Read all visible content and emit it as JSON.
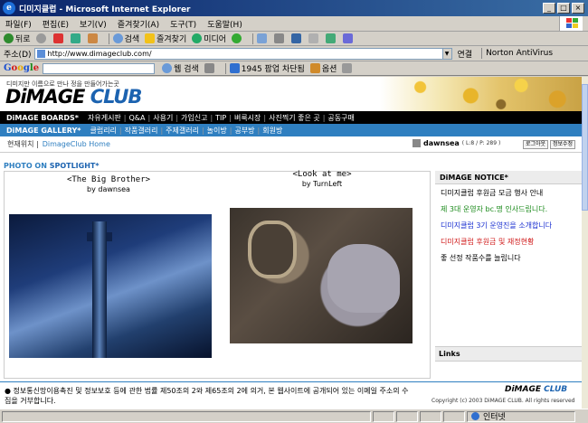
{
  "window": {
    "title": "디미지클럽 - Microsoft Internet Explorer",
    "min_glyph": "_",
    "max_glyph": "□",
    "close_glyph": "×"
  },
  "menu": {
    "items": [
      "파일(F)",
      "편집(E)",
      "보기(V)",
      "즐겨찾기(A)",
      "도구(T)",
      "도움말(H)"
    ]
  },
  "toolbar": {
    "back": "뒤로",
    "search": "검색",
    "favorites": "즐겨찾기",
    "media": "미디어"
  },
  "address": {
    "label": "주소(D)",
    "url": "http://www.dimageclub.com/",
    "go": "연결",
    "antivirus": "Norton AntiVirus"
  },
  "google": {
    "logo": "Google",
    "web_search": "웹 검색",
    "popup_blocked": "1945 팝업 차단됨",
    "options": "옵션"
  },
  "site": {
    "tagline": "디미지만 이름으로 만나 정을 만들어가는곳",
    "logo_main": "DiMAGE ",
    "logo_club": "CLUB",
    "boards_label": "DiMAGE BOARDS*",
    "boards": [
      "자유게시판",
      "Q&A",
      "사용기",
      "가입신고",
      "TIP",
      "벼룩시장",
      "사진찍기 좋은 곳",
      "공동구매"
    ],
    "gallery_label": "DiMAGE GALLERY*",
    "gallery": [
      "클럽리리",
      "작품갤러리",
      "주제갤러리",
      "놀이방",
      "공부방",
      "회원방"
    ],
    "crumb_here": "현재위치 |",
    "crumb_home": "DimageClub Home",
    "user_name": "dawnsea",
    "user_level": "( L:8 / P: 289 )",
    "logout": "로그아웃",
    "edit_info": "정보수정"
  },
  "spotlight": {
    "label": "PHOTO ON ",
    "label_strong": "SPOTLIGHT*",
    "photos": [
      {
        "title": "<The Big Brother>",
        "by": "by dawnsea"
      },
      {
        "title": "<Look at me>",
        "by": "by TurnLeft"
      }
    ]
  },
  "notice": {
    "header": "DiMAGE NOTICE*",
    "items": [
      {
        "text": "디미지클럽 후원금 모금 행사 안내",
        "color": "#000000"
      },
      {
        "text": "제 3대 운영자 bc.명 인사드립니다.",
        "color": "#1a8a1a"
      },
      {
        "text": "디미지클럽 3기 운영진을 소개합니다",
        "color": "#1a2fd0"
      },
      {
        "text": "디미지클럽 후원금 및 재정현황",
        "color": "#d01a1a"
      },
      {
        "text": "좋 선정 작품수를 늘립니다",
        "color": "#000000"
      }
    ],
    "links_header": "Links"
  },
  "footer": {
    "text": "● 정보통신망이용촉진 및 정보보호 등에 관한 법률 제50조의 2와 제65조의 2에 의거, 본 웹사이트에 공개되어 있는 이메일 주소의 수집을 거부합니다.",
    "logo_main": "DiMAGE ",
    "logo_club": "CLUB",
    "copyright": "Copyright (c) 2003  DiMAGE CLUB. All rights reserved"
  },
  "status": {
    "zone": "인터넷"
  }
}
